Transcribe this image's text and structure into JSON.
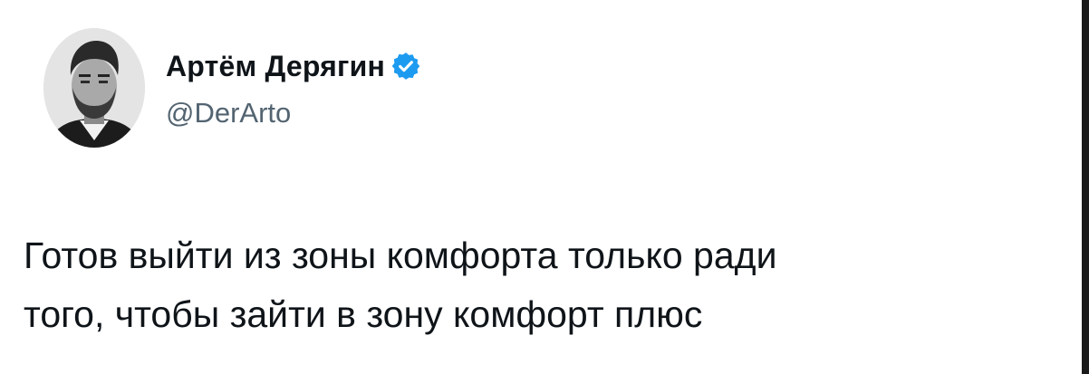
{
  "author": {
    "display_name": "Артём Дерягин",
    "handle": "@DerArto",
    "verified": true,
    "avatar_icon": "profile-photo"
  },
  "tweet": {
    "lines": [
      "Готов выйти из зоны комфорта только ради",
      "того, чтобы зайти в зону комфорт плюс"
    ]
  },
  "colors": {
    "text": "#0f1419",
    "secondary": "#536471",
    "verified_badge": "#1d9bf0"
  }
}
